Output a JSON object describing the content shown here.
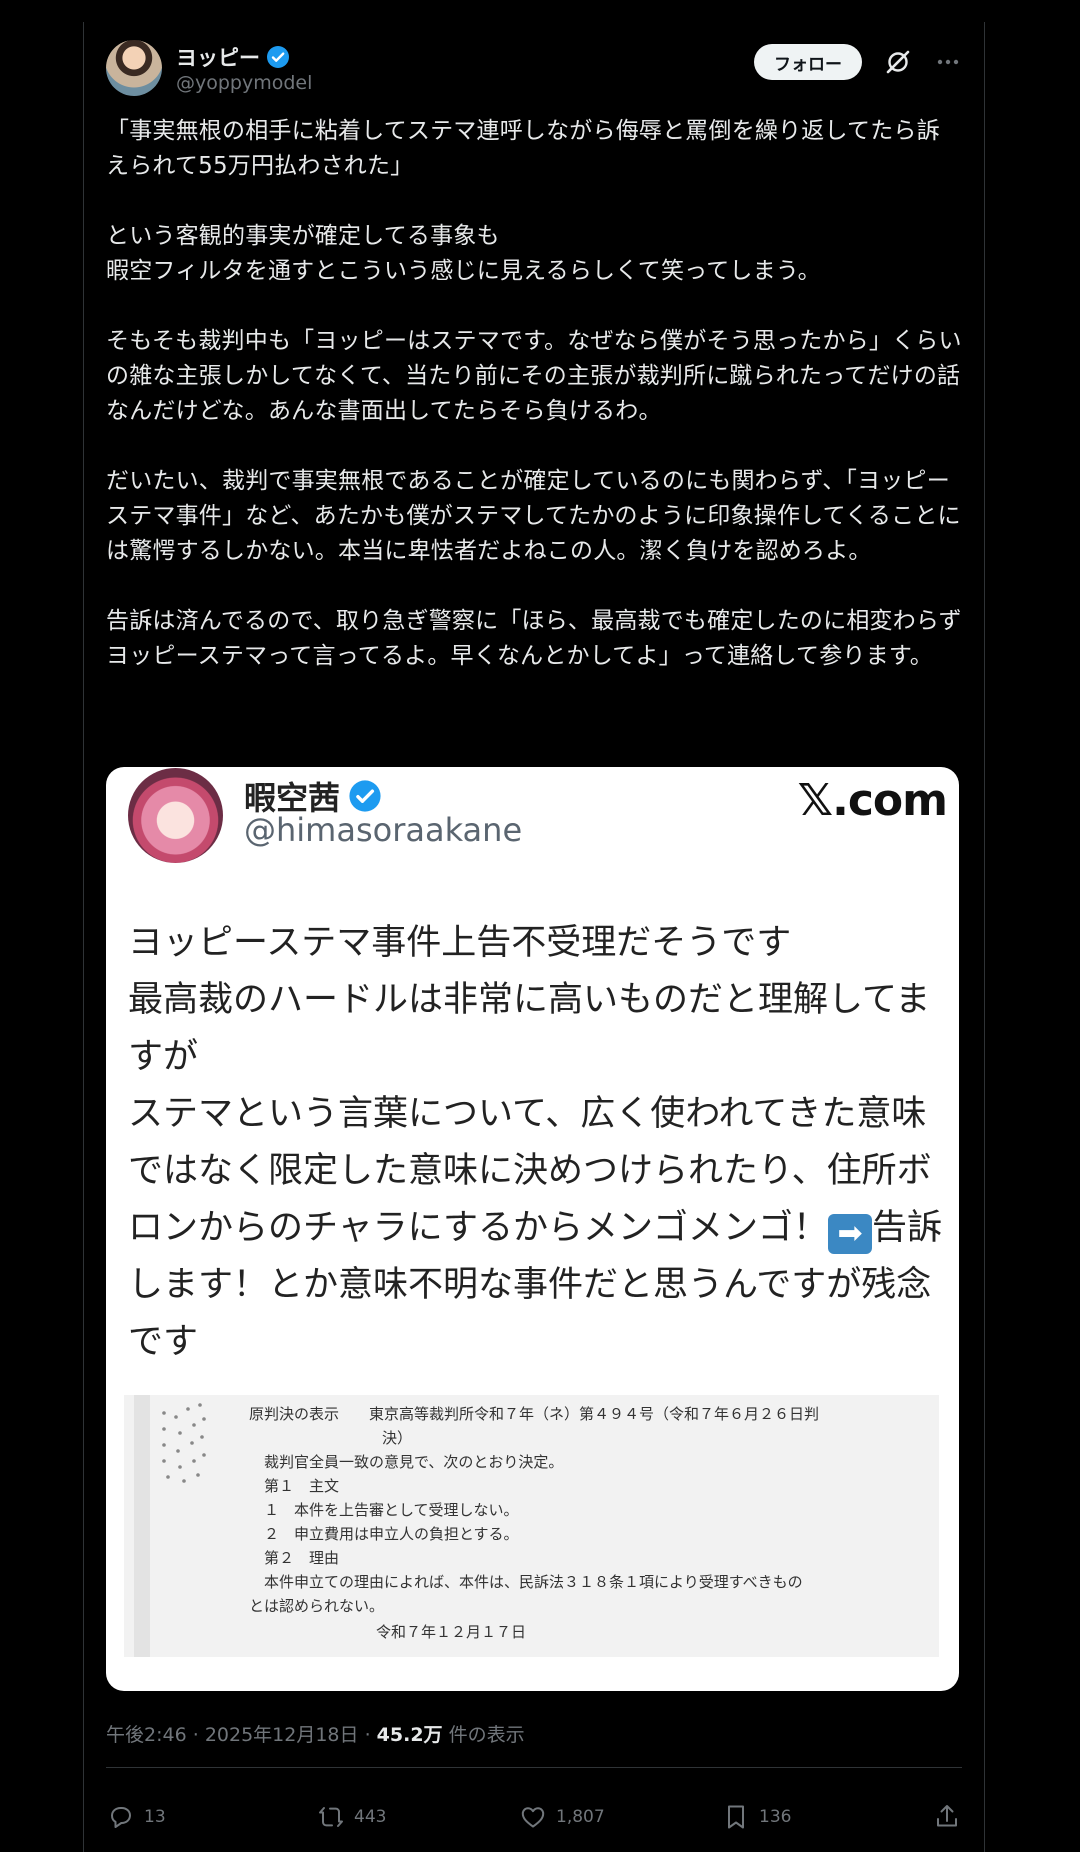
{
  "author": {
    "display_name": "ヨッピー",
    "handle": "@yoppymodel",
    "verified": true
  },
  "header": {
    "follow_label": "フォロー"
  },
  "tweet": {
    "text": "「事実無根の相手に粘着してステマ連呼しながら侮辱と罵倒を繰り返してたら訴えられて55万円払わされた」\n\nという客観的事実が確定してる事象も\n暇空フィルタを通すとこういう感じに見えるらしくて笑ってしまう。\n\nそもそも裁判中も「ヨッピーはステマです。なぜなら僕がそう思ったから」くらいの雑な主張しかしてなくて、当たり前にその主張が裁判所に蹴られたってだけの話なんだけどな。あんな書面出してたらそら負けるわ。\n\nだいたい、裁判で事実無根であることが確定しているのにも関わらず、「ヨッピーステマ事件」など、あたかも僕がステマしてたかのように印象操作してくることには驚愕するしかない。本当に卑怯者だよねこの人。潔く負けを認めろよ。\n\n告訴は済んでるので、取り急ぎ警察に「ほら、最高裁でも確定したのに相変わらずヨッピーステマって言ってるよ。早くなんとかしてよ」って連絡して参ります。"
  },
  "quoted": {
    "display_name": "暇空茜",
    "handle": "@himasoraakane",
    "site_label": "𝕏.com",
    "text_before_emoji": "ヨッピーステマ事件上告不受理だそうです\n最高裁のハードルは非常に高いものだと理解してますが\nステマという言葉について、広く使われてきた意味ではなく限定した意味に決めつけられたり、住所ボロンからのチャラにするからメンゴメンゴ！",
    "emoji": "➡",
    "text_after_emoji": "告訴します！とか意味不明な事件だと思うんですが残念です",
    "document_lines": [
      "原判決の表示　　東京高等裁判所令和７年（ネ）第４９４号（令和７年６月２６日判",
      "決）",
      "裁判官全員一致の意見で、次のとおり決定。",
      "第１　主文",
      "１　本件を上告審として受理しない。",
      "２　申立費用は申立人の負担とする。",
      "第２　理由",
      "本件申立ての理由によれば、本件は、民訴法３１８条１項により受理すべきもの",
      "とは認められない。",
      "令和７年１２月１７日"
    ]
  },
  "meta": {
    "time": "午後2:46",
    "separator": "·",
    "date": "2025年12月18日",
    "views_count": "45.2万",
    "views_label": "件の表示"
  },
  "actions": {
    "replies": "13",
    "reposts": "443",
    "likes": "1,807",
    "bookmarks": "136"
  },
  "colors": {
    "background": "#000000",
    "text": "#e7e9ea",
    "secondary_text": "#71767b",
    "verified_blue": "#1d9bf0",
    "follow_button_bg": "#eff3f4"
  }
}
